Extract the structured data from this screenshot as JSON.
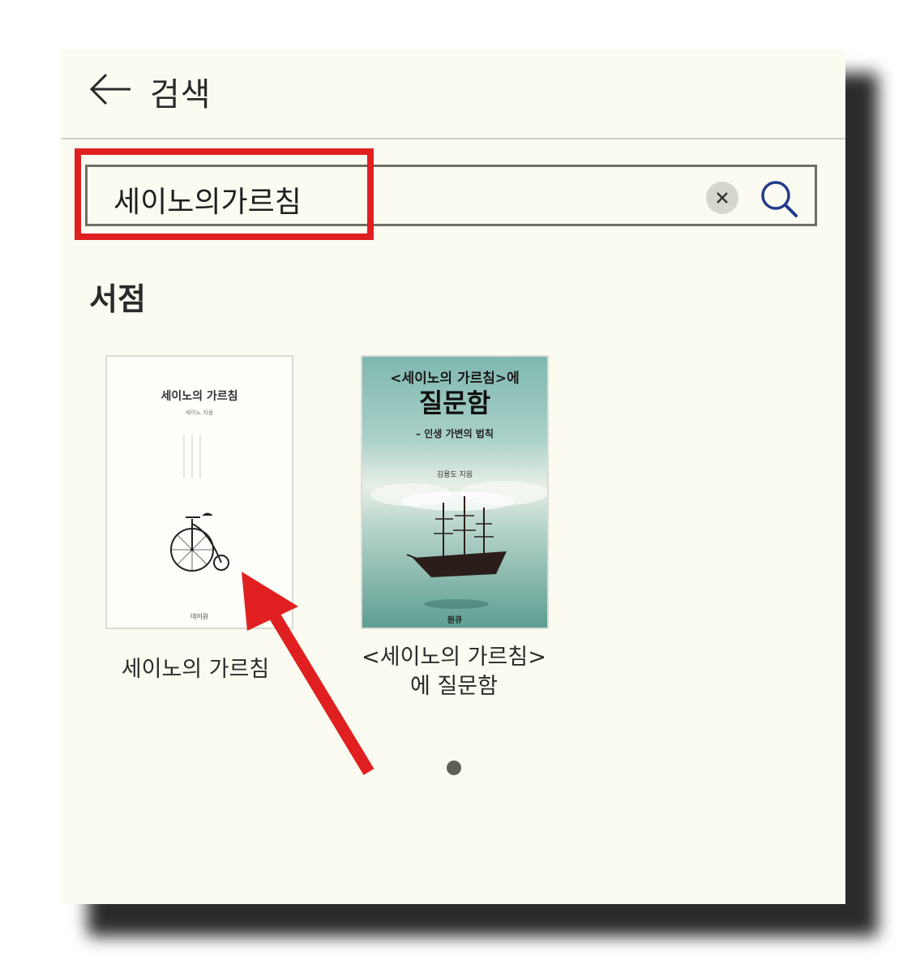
{
  "header": {
    "back_icon": "arrow-left-icon",
    "title": "검색"
  },
  "search": {
    "value": "세이노의가르침",
    "clear_icon": "close-icon",
    "search_icon": "search-icon"
  },
  "section": {
    "title": "서점"
  },
  "books": [
    {
      "label": "세이노의 가르침",
      "cover": {
        "title": "세이노의 가르침",
        "author": "세이노 지음",
        "publisher": "데이원",
        "image_icon": "penny-farthing-bicycle-icon"
      }
    },
    {
      "label_line1": "<세이노의 가르침>",
      "label_line2": "에 질문함",
      "cover": {
        "top": "<세이노의 가르침>에",
        "big": "질문함",
        "subtitle": "– 인생 가변의 법칙",
        "author": "김용도 지음",
        "publisher": "원큐",
        "image_icon": "sailing-ship-icon"
      }
    }
  ],
  "pagination": {
    "pages": 1,
    "current": 1
  },
  "annotation": {
    "highlight_color": "#e02020",
    "arrow_icon": "red-arrow-icon"
  },
  "colors": {
    "background": "#fbfbf1",
    "search_icon": "#233a8c"
  }
}
